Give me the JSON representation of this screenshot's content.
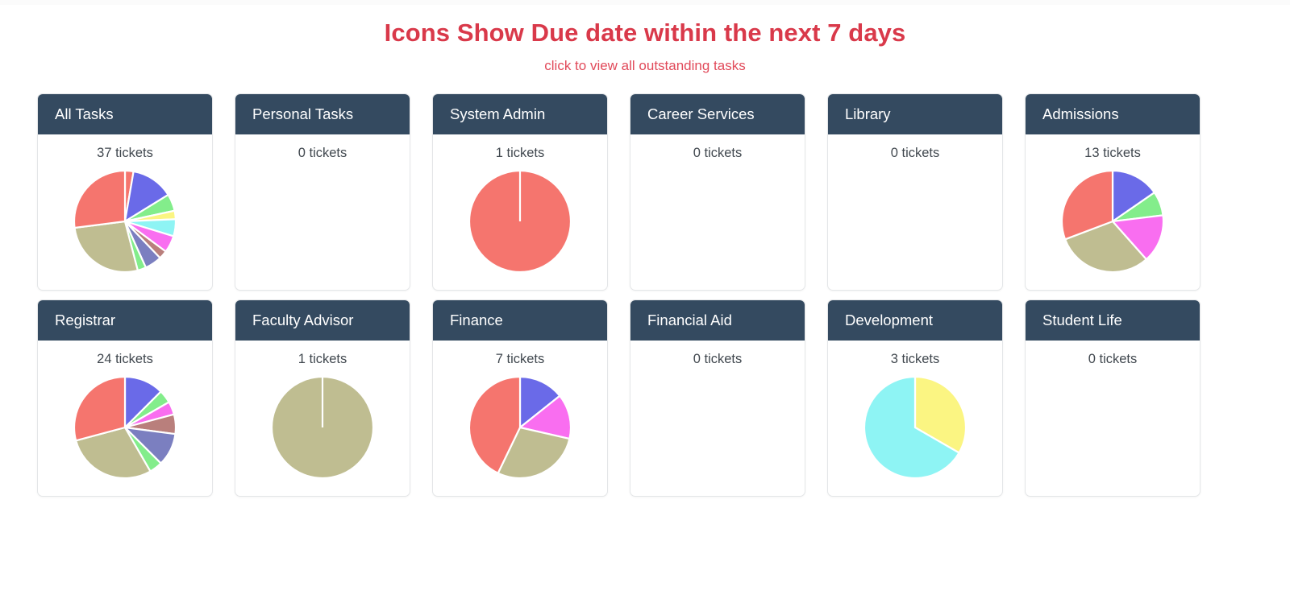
{
  "header": {
    "title": "Icons Show Due date within the next 7 days",
    "subtitle": "click to view all outstanding tasks",
    "title_color": "#d9394a",
    "subtitle_color": "#e14a5a"
  },
  "theme": {
    "card_header_bg": "#344a60",
    "card_header_text": "#ffffff",
    "card_border": "#e4e6e8",
    "page_bg": "#ffffff",
    "count_text": "#41484f"
  },
  "palette": {
    "salmon": "#f5756e",
    "blue": "#6a6ae8",
    "green": "#83ed8b",
    "yellow": "#fbf582",
    "cyan": "#8ef4f4",
    "magenta": "#f96ef0",
    "brown": "#b97f7c",
    "slate": "#7b7fc0",
    "khaki": "#bfbd91"
  },
  "cards": [
    {
      "name": "all-tasks",
      "title": "All Tasks",
      "count_label": "37 tickets",
      "count": 37,
      "has_pie": true,
      "pie_radius": 63,
      "chart_data": {
        "type": "pie",
        "title": "All Tasks",
        "total": 37,
        "start_angle": 0,
        "labels": [
          "salmon-a",
          "blue",
          "green-a",
          "yellow",
          "cyan",
          "magenta",
          "brown",
          "slate",
          "green-b",
          "khaki",
          "salmon-b"
        ],
        "values": [
          1,
          5,
          2,
          1,
          2,
          2,
          1,
          2,
          1,
          10,
          10
        ],
        "colors": [
          "#f5756e",
          "#6a6ae8",
          "#83ed8b",
          "#fbf582",
          "#8ef4f4",
          "#f96ef0",
          "#b97f7c",
          "#7b7fc0",
          "#83ed8b",
          "#bfbd91",
          "#f5756e"
        ]
      }
    },
    {
      "name": "personal-tasks",
      "title": "Personal Tasks",
      "count_label": "0 tickets",
      "count": 0,
      "has_pie": false,
      "chart_data": {
        "type": "pie",
        "title": "Personal Tasks",
        "total": 0,
        "labels": [],
        "values": [],
        "colors": []
      }
    },
    {
      "name": "system-admin",
      "title": "System Admin",
      "count_label": "1 tickets",
      "count": 1,
      "has_pie": true,
      "pie_radius": 63,
      "chart_data": {
        "type": "pie",
        "title": "System Admin",
        "total": 1,
        "start_angle": 0,
        "labels": [
          "salmon"
        ],
        "values": [
          1
        ],
        "colors": [
          "#f5756e"
        ]
      }
    },
    {
      "name": "career-services",
      "title": "Career Services",
      "count_label": "0 tickets",
      "count": 0,
      "has_pie": false,
      "chart_data": {
        "type": "pie",
        "title": "Career Services",
        "total": 0,
        "labels": [],
        "values": [],
        "colors": []
      }
    },
    {
      "name": "library",
      "title": "Library",
      "count_label": "0 tickets",
      "count": 0,
      "has_pie": false,
      "chart_data": {
        "type": "pie",
        "title": "Library",
        "total": 0,
        "labels": [],
        "values": [],
        "colors": []
      }
    },
    {
      "name": "admissions",
      "title": "Admissions",
      "count_label": "13 tickets",
      "count": 13,
      "has_pie": true,
      "pie_radius": 63,
      "chart_data": {
        "type": "pie",
        "title": "Admissions",
        "total": 13,
        "start_angle": 0,
        "labels": [
          "blue",
          "green",
          "magenta",
          "khaki",
          "salmon"
        ],
        "values": [
          2,
          1,
          2,
          4,
          4
        ],
        "colors": [
          "#6a6ae8",
          "#83ed8b",
          "#f96ef0",
          "#bfbd91",
          "#f5756e"
        ]
      }
    },
    {
      "name": "registrar",
      "title": "Registrar",
      "count_label": "24 tickets",
      "count": 24,
      "has_pie": true,
      "pie_radius": 63,
      "chart_data": {
        "type": "pie",
        "title": "Registrar",
        "total": 24,
        "start_angle": 0,
        "labels": [
          "blue",
          "green-a",
          "magenta",
          "brown",
          "slate",
          "green-b",
          "khaki",
          "salmon"
        ],
        "values": [
          3,
          1,
          1,
          1.5,
          2.5,
          1,
          7,
          7
        ],
        "colors": [
          "#6a6ae8",
          "#83ed8b",
          "#f96ef0",
          "#b97f7c",
          "#7b7fc0",
          "#83ed8b",
          "#bfbd91",
          "#f5756e"
        ]
      }
    },
    {
      "name": "faculty-advisor",
      "title": "Faculty Advisor",
      "count_label": "1 tickets",
      "count": 1,
      "has_pie": true,
      "pie_radius": 63,
      "chart_data": {
        "type": "pie",
        "title": "Faculty Advisor",
        "total": 1,
        "start_angle": 0,
        "labels": [
          "khaki"
        ],
        "values": [
          1
        ],
        "colors": [
          "#bfbd91"
        ]
      }
    },
    {
      "name": "finance",
      "title": "Finance",
      "count_label": "7 tickets",
      "count": 7,
      "has_pie": true,
      "pie_radius": 63,
      "chart_data": {
        "type": "pie",
        "title": "Finance",
        "total": 7,
        "start_angle": 0,
        "labels": [
          "blue",
          "magenta",
          "khaki",
          "salmon"
        ],
        "values": [
          1,
          1,
          2,
          3
        ],
        "colors": [
          "#6a6ae8",
          "#f96ef0",
          "#bfbd91",
          "#f5756e"
        ]
      }
    },
    {
      "name": "financial-aid",
      "title": "Financial Aid",
      "count_label": "0 tickets",
      "count": 0,
      "has_pie": false,
      "chart_data": {
        "type": "pie",
        "title": "Financial Aid",
        "total": 0,
        "labels": [],
        "values": [],
        "colors": []
      }
    },
    {
      "name": "development",
      "title": "Development",
      "count_label": "3 tickets",
      "count": 3,
      "has_pie": true,
      "pie_radius": 63,
      "chart_data": {
        "type": "pie",
        "title": "Development",
        "total": 3,
        "start_angle": 0,
        "labels": [
          "yellow",
          "cyan"
        ],
        "values": [
          1,
          2
        ],
        "colors": [
          "#fbf582",
          "#8ef4f4"
        ]
      }
    },
    {
      "name": "student-life",
      "title": "Student Life",
      "count_label": "0 tickets",
      "count": 0,
      "has_pie": false,
      "chart_data": {
        "type": "pie",
        "title": "Student Life",
        "total": 0,
        "labels": [],
        "values": [],
        "colors": []
      }
    }
  ]
}
